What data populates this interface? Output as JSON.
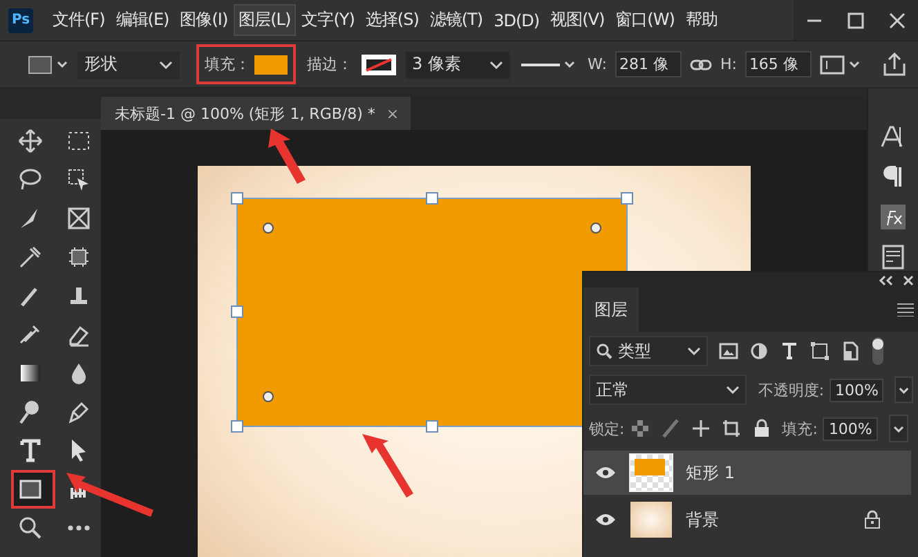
{
  "app": {
    "logo": "Ps"
  },
  "menu": [
    {
      "label": "文件(F)",
      "selected": false
    },
    {
      "label": "编辑(E)",
      "selected": false
    },
    {
      "label": "图像(I)",
      "selected": false
    },
    {
      "label": "图层(L)",
      "selected": true
    },
    {
      "label": "文字(Y)",
      "selected": false
    },
    {
      "label": "选择(S)",
      "selected": false
    },
    {
      "label": "滤镜(T)",
      "selected": false
    },
    {
      "label": "3D(D)",
      "selected": false
    },
    {
      "label": "视图(V)",
      "selected": false
    },
    {
      "label": "窗口(W)",
      "selected": false
    },
    {
      "label": "帮助",
      "selected": false
    }
  ],
  "options_bar": {
    "mode": "形状",
    "fill_label": "填充：",
    "stroke_label": "描边：",
    "stroke_width": "3 像素",
    "w_label": "W:",
    "w_value": "281 像",
    "h_label": "H:",
    "h_value": "165 像"
  },
  "document_tab": {
    "title": "未标题-1 @ 100% (矩形 1, RGB/8) *",
    "close": "×"
  },
  "tools": [
    {
      "selected": false
    },
    {
      "selected": false
    },
    {
      "selected": false
    },
    {
      "selected": false
    },
    {
      "selected": false
    },
    {
      "selected": false
    },
    {
      "selected": false
    },
    {
      "selected": false
    },
    {
      "selected": false
    },
    {
      "selected": false
    },
    {
      "selected": false
    },
    {
      "selected": false
    },
    {
      "selected": false
    },
    {
      "selected": false
    },
    {
      "selected": false
    },
    {
      "selected": false
    },
    {
      "selected": false
    },
    {
      "selected": false
    },
    {
      "selected": true
    },
    {
      "selected": false
    },
    {
      "selected": false
    },
    {
      "selected": false
    }
  ],
  "layers_panel": {
    "title": "图层",
    "filter": "类型",
    "blend_mode": "正常",
    "opacity_label": "不透明度:",
    "opacity": "100%",
    "lock_label": "锁定:",
    "fill_label": "填充:",
    "fill": "100%",
    "layers": [
      {
        "name": "矩形 1",
        "kind": "shape",
        "selected": true,
        "visible": true,
        "locked": false
      },
      {
        "name": "背景",
        "kind": "background",
        "selected": false,
        "visible": true,
        "locked": true
      }
    ]
  }
}
